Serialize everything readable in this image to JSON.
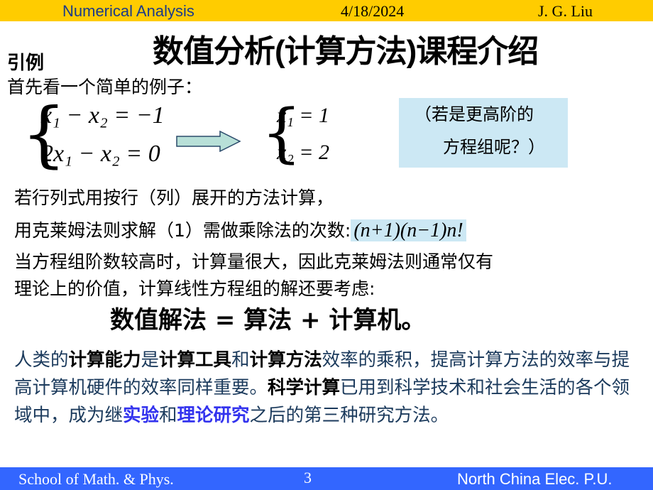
{
  "header": {
    "course": "Numerical Analysis",
    "date": "4/18/2024",
    "author": "J. G. Liu"
  },
  "title": "数值分析(计算方法)课程介绍",
  "section": "引例",
  "intro": "首先看一个简单的例子：",
  "system": {
    "eq1": "x₁ − x₂ = −1",
    "eq2": "2x₁ − x₂ = 0"
  },
  "solution": {
    "eq1": "x₁ = 1",
    "eq2": "x₂ = 2"
  },
  "note": {
    "line1": "（若是更高阶的",
    "line2": "方程组呢？）"
  },
  "lines": {
    "l1": "若行列式用按行（列）展开的方法计算，",
    "l2": "用克莱姆法则求解（1）需做乘除法的次数:",
    "l2_formula": "(n+1)(n−1)n!",
    "l3": "当方程组阶数较高时，计算量很大，因此克莱姆法则通常仅有",
    "l4": "理论上的价值，计算线性方程组的解还要考虑:"
  },
  "formula": "数值解法 = 算法 + 计算机。",
  "paragraph": {
    "p1": "人类的",
    "b1": "计算能力",
    "p2": "是",
    "b2": "计算工具",
    "p3": "和",
    "b3": "计算方法",
    "p4": "效率的乘积，提高计算方法的效率与提高计算机硬件的效率同样重要。",
    "b4": "科学计算",
    "p5": "已用到科学技术和社会生活的各个领域中，成为继",
    "c1": "实验",
    "p6": "和",
    "c2": "理论研究",
    "p7": "之后的第三种研究方法。"
  },
  "footer": {
    "school": "School of Math. & Phys.",
    "page": "3",
    "university": "North China Elec. P.U."
  },
  "colors": {
    "header": "#ffcc00",
    "footer": "#3366ff",
    "highlight": "#cce8f4",
    "emphasis": "#3333ee",
    "arrow": "#b8e0d8"
  }
}
